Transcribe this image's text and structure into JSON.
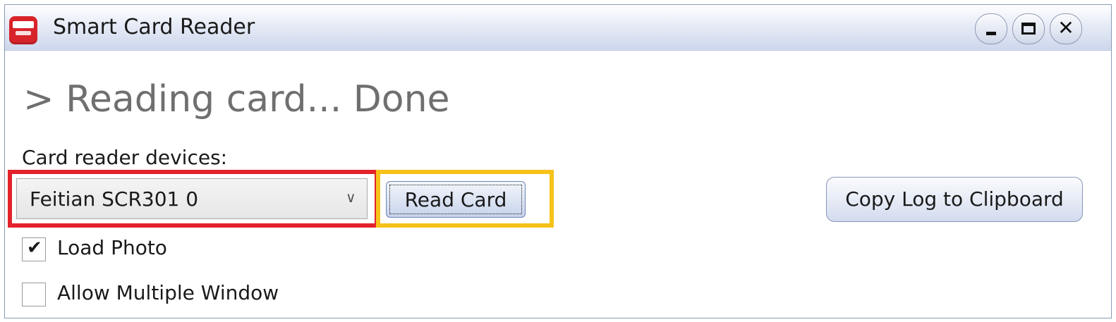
{
  "window": {
    "title": "Smart Card Reader",
    "icon": "app-logo-icon",
    "controls": {
      "minimize": "minimize-icon",
      "maximize": "maximize-icon",
      "close_glyph": "✕"
    }
  },
  "status": {
    "text": "> Reading card... Done"
  },
  "devices": {
    "label": "Card reader devices:",
    "selected": "Feitian SCR301 0"
  },
  "buttons": {
    "read_card": "Read Card",
    "copy_log": "Copy Log to Clipboard"
  },
  "options": [
    {
      "label": "Load Photo",
      "checked": true
    },
    {
      "label": "Allow Multiple Window",
      "checked": false
    }
  ],
  "colors": {
    "highlight_red": "#e3222b",
    "highlight_yellow": "#f6c21a",
    "app_icon_red": "#d8232a"
  }
}
